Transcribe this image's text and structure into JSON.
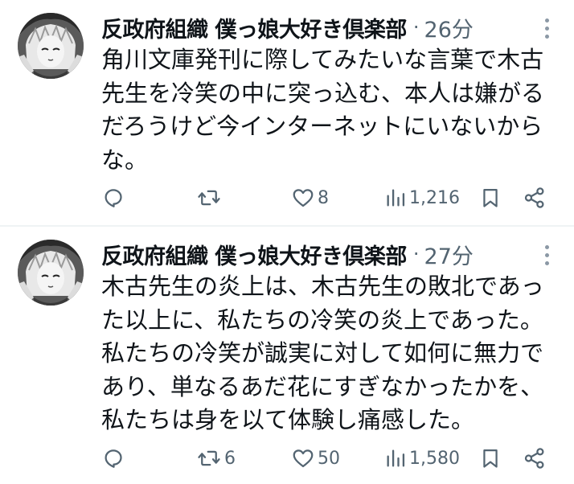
{
  "tweets": [
    {
      "author": "反政府組織 僕っ娘大好き倶楽部",
      "separator": "·",
      "time": "26分",
      "text_lines": [
        "角川文庫発刊に際してみたいな言葉で木古",
        "先生を冷笑の中に突っ込む、本人は嫌がる",
        "だろうけど今インターネットにいないから",
        "な。"
      ],
      "actions": {
        "reply_count": "",
        "retweet_count": "",
        "like_count": "8",
        "views_count": "1,216"
      }
    },
    {
      "author": "反政府組織 僕っ娘大好き倶楽部",
      "separator": "·",
      "time": "27分",
      "text_lines": [
        "木古先生の炎上は、木古先生の敗北であっ",
        "た以上に、私たちの冷笑の炎上であった。",
        "私たちの冷笑が誠実に対して如何に無力で",
        "あり、単なるあだ花にすぎなかったかを、",
        "私たちは身を以て体験し痛感した。"
      ],
      "actions": {
        "reply_count": "",
        "retweet_count": "6",
        "like_count": "50",
        "views_count": "1,580"
      }
    }
  ],
  "icons": {
    "avatar": "anime-avatar",
    "more": "more-vertical-icon",
    "reply": "reply-icon",
    "retweet": "retweet-icon",
    "like": "heart-icon",
    "views": "views-icon",
    "bookmark": "bookmark-icon",
    "share": "share-icon"
  },
  "colors": {
    "text": "#0f1419",
    "secondary": "#536471",
    "divider": "#eff3f4"
  }
}
